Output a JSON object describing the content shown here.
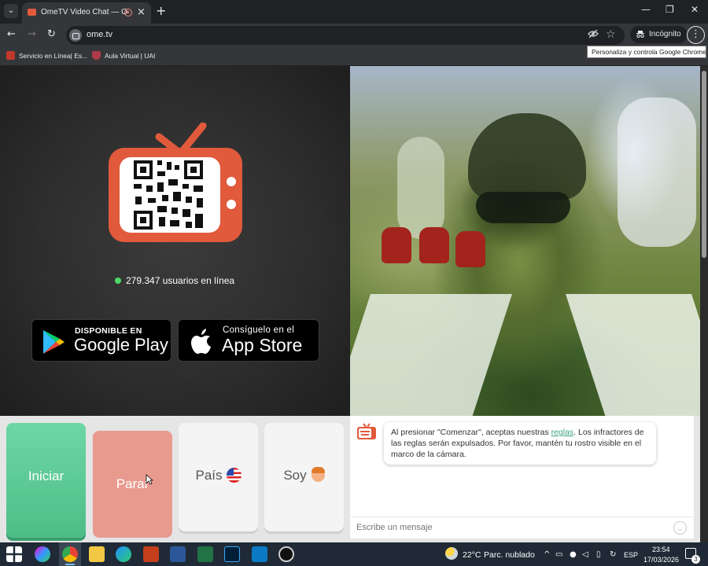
{
  "browser": {
    "tab_title": "OmeTV Video Chat — Ome",
    "url": "ome.tv",
    "incognito_label": "Incógnito",
    "tooltip": "Personaliza y controla Google Chrome",
    "bookmarks": [
      {
        "label": "Servicio en Línea| Es..."
      },
      {
        "label": "Aula Virtual | UAI"
      }
    ]
  },
  "page": {
    "online_count": "279.347 usuarios en línea",
    "google_play": {
      "small": "DISPONIBLE EN",
      "big": "Google Play"
    },
    "app_store": {
      "small": "Consíguelo en el",
      "big": "App Store"
    },
    "controls": {
      "start": "Iniciar",
      "stop": "Parar",
      "country": "País",
      "gender": "Soy"
    },
    "chat": {
      "notice_before": "Al presionar \"Comenzar\", aceptas nuestras ",
      "notice_link": "reglas",
      "notice_after": ". Los infractores de las reglas serán expulsados. Por favor, mantén tu rostro visible en el marco de la cámara.",
      "input_placeholder": "Escribe un mensaje"
    }
  },
  "taskbar": {
    "weather_temp": "22°C",
    "weather_desc": "Parc. nublado",
    "language": "ESP",
    "time": "23:54",
    "date": "17/03/2026",
    "notification_count": "3"
  },
  "colors": {
    "brand_orange": "#e05a3b",
    "start_green": "#4dbd87",
    "stop_salmon": "#e89a8e",
    "link_teal": "#3aa384",
    "online_green": "#4cd964"
  },
  "icons": [
    "tab-list-icon",
    "close-icon",
    "plus-icon",
    "minimize-icon",
    "restore-icon",
    "back-icon",
    "forward-icon",
    "reload-icon",
    "eye-off-icon",
    "star-icon",
    "incognito-icon",
    "menu-dots-icon",
    "tv-logo-icon",
    "qr-code-icon",
    "google-play-icon",
    "apple-icon",
    "us-flag-icon",
    "avatar-icon",
    "smile-icon",
    "windows-icon"
  ]
}
